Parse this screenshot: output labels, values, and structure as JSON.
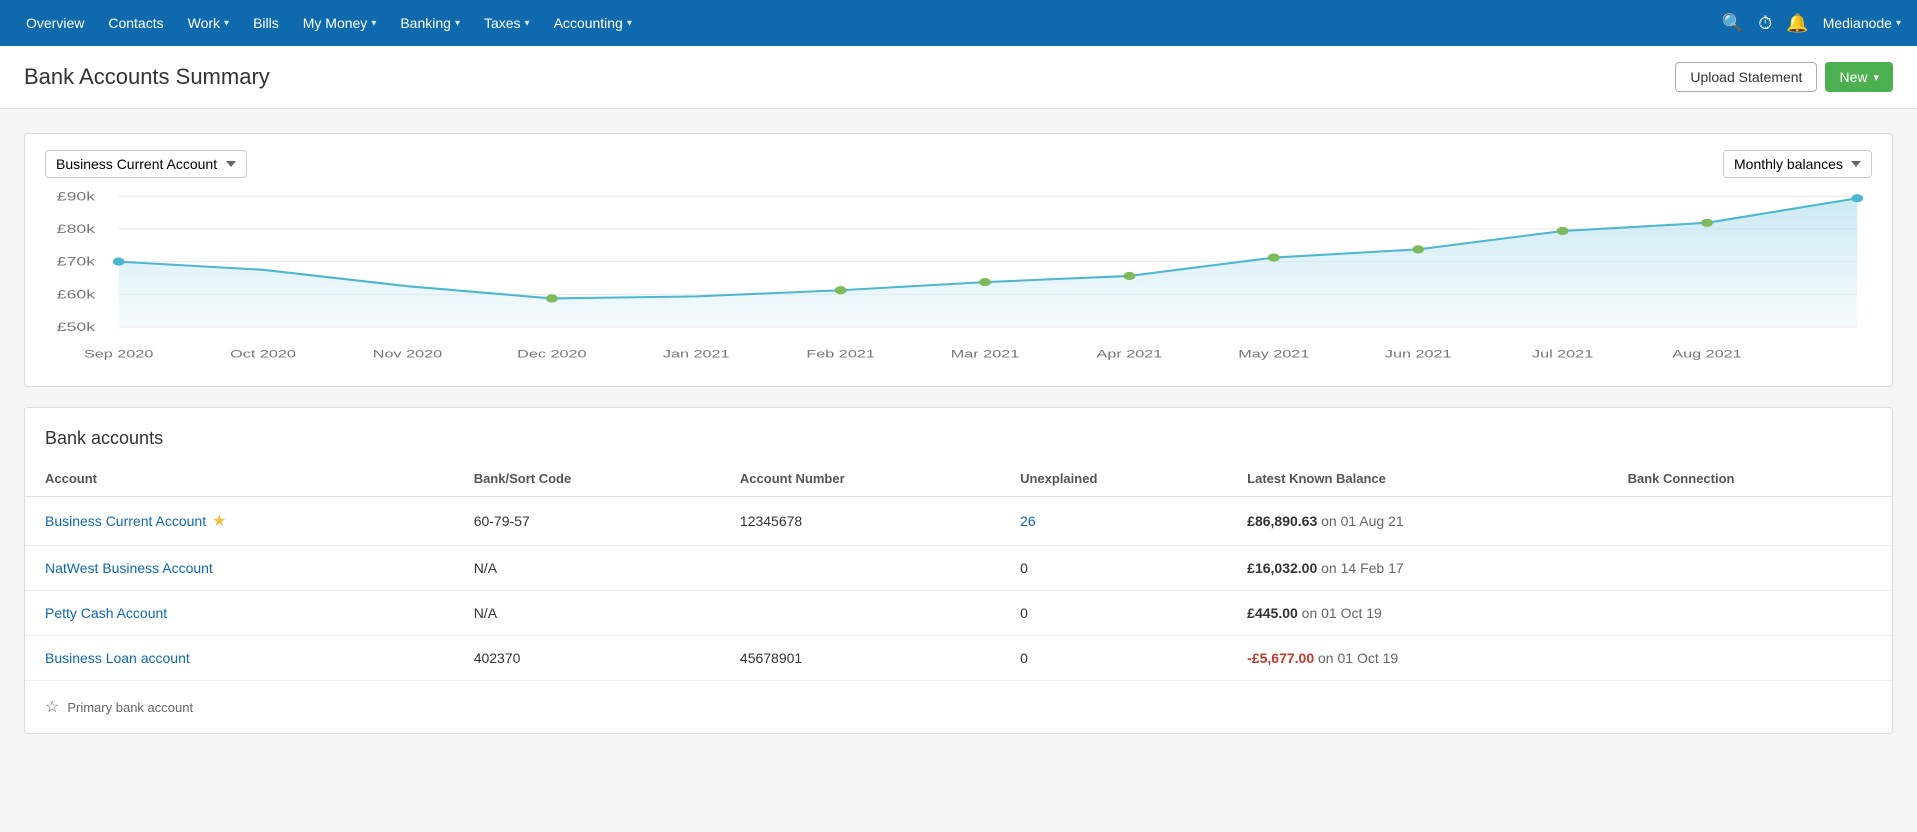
{
  "navbar": {
    "items": [
      {
        "label": "Overview",
        "has_dropdown": false
      },
      {
        "label": "Contacts",
        "has_dropdown": false
      },
      {
        "label": "Work",
        "has_dropdown": true
      },
      {
        "label": "Bills",
        "has_dropdown": false
      },
      {
        "label": "My Money",
        "has_dropdown": true
      },
      {
        "label": "Banking",
        "has_dropdown": true
      },
      {
        "label": "Taxes",
        "has_dropdown": true
      },
      {
        "label": "Accounting",
        "has_dropdown": true
      }
    ],
    "user": "Medianode",
    "search_icon": "🔍",
    "timer_icon": "⏱",
    "bell_icon": "🔔"
  },
  "page_header": {
    "title": "Bank Accounts Summary",
    "upload_btn": "Upload Statement",
    "new_btn": "New"
  },
  "chart": {
    "account_selector": "Business Current Account",
    "view_selector": "Monthly balances",
    "y_labels": [
      "£90k",
      "£80k",
      "£70k",
      "£60k",
      "£50k"
    ],
    "x_labels": [
      "Sep 2020",
      "Oct 2020",
      "Nov 2020",
      "Dec 2020",
      "Jan 2021",
      "Feb 2021",
      "Mar 2021",
      "Apr 2021",
      "May 2021",
      "Jun 2021",
      "Jul 2021",
      "Aug 2021"
    ]
  },
  "bank_accounts": {
    "section_title": "Bank accounts",
    "columns": [
      "Account",
      "Bank/Sort Code",
      "Account Number",
      "Unexplained",
      "Latest Known Balance",
      "Bank Connection"
    ],
    "rows": [
      {
        "name": "Business Current Account",
        "is_primary": true,
        "sort_code": "60-79-57",
        "account_number": "12345678",
        "unexplained": "26",
        "balance": "£86,890.63",
        "balance_date": "on 01 Aug 21",
        "balance_negative": false,
        "bank_connection": ""
      },
      {
        "name": "NatWest Business Account",
        "is_primary": false,
        "sort_code": "N/A",
        "account_number": "",
        "unexplained": "0",
        "balance": "£16,032.00",
        "balance_date": "on 14 Feb 17",
        "balance_negative": false,
        "bank_connection": ""
      },
      {
        "name": "Petty Cash Account",
        "is_primary": false,
        "sort_code": "N/A",
        "account_number": "",
        "unexplained": "0",
        "balance": "£445.00",
        "balance_date": "on 01 Oct 19",
        "balance_negative": false,
        "bank_connection": ""
      },
      {
        "name": "Business Loan account",
        "is_primary": false,
        "sort_code": "402370",
        "account_number": "45678901",
        "unexplained": "0",
        "balance": "-£5,677.00",
        "balance_date": "on 01 Oct 19",
        "balance_negative": true,
        "bank_connection": ""
      }
    ]
  },
  "footer": {
    "note": "Primary bank account"
  }
}
